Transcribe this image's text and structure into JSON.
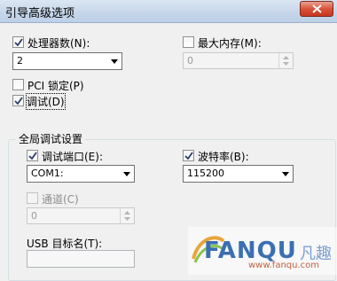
{
  "window": {
    "title": "引导高级选项"
  },
  "processors": {
    "label": "处理器数(N):",
    "checked": true,
    "value": "2"
  },
  "max_memory": {
    "label": "最大内存(M):",
    "checked": false,
    "value": "0"
  },
  "pci_lock": {
    "label": "PCI 锁定(P)",
    "checked": false
  },
  "debug": {
    "label": "调试(D)",
    "checked": true
  },
  "global_debug": {
    "title": "全局调试设置",
    "debug_port": {
      "label": "调试端口(E):",
      "checked": true,
      "value": "COM1:"
    },
    "baud_rate": {
      "label": "波特率(B):",
      "checked": true,
      "value": "115200"
    },
    "channel": {
      "label": "通道(C)",
      "checked": false,
      "value": "0"
    },
    "usb_target": {
      "label": "USB 目标名(T):",
      "value": ""
    }
  },
  "watermark": {
    "brand": "FANQU",
    "cn": "凡趣",
    "url": "www.fanqu.com"
  },
  "colors": {
    "titlebar": "#c7d7ea",
    "close": "#d9533a",
    "window_bg": "#f0f0f0"
  }
}
